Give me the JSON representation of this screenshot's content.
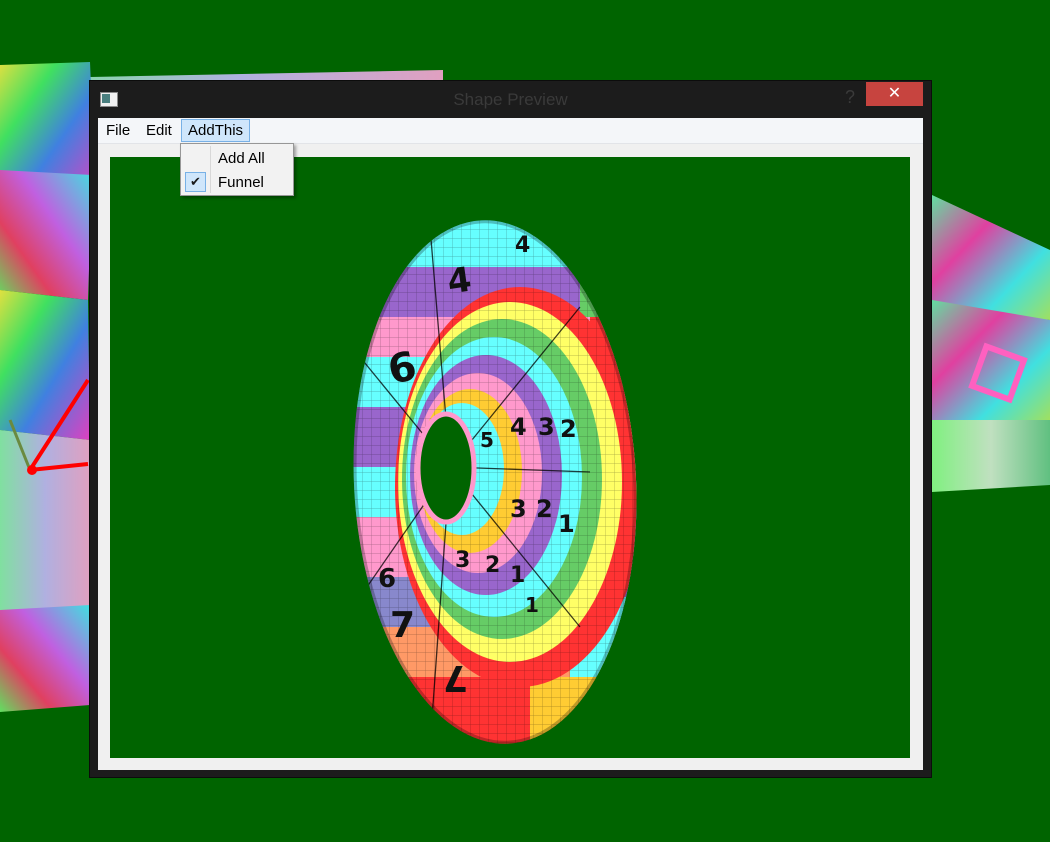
{
  "window": {
    "title": "Shape Preview",
    "help_glyph": "?",
    "close_glyph": "✕"
  },
  "menubar": {
    "items": [
      {
        "label": "File"
      },
      {
        "label": "Edit"
      },
      {
        "label": "AddThis",
        "active": true
      }
    ]
  },
  "dropdown": {
    "items": [
      {
        "label": "Add All",
        "checked": false
      },
      {
        "label": "Funnel",
        "checked": true
      }
    ],
    "check_glyph": "✔"
  },
  "scene": {
    "background_color": "#006400",
    "shape": "funnel",
    "stripe_colors": [
      "#ff3333",
      "#ff9966",
      "#ffff66",
      "#66cc66",
      "#66ffff",
      "#9966cc",
      "#ff99cc",
      "#8888cc",
      "#ffcc33"
    ],
    "digit_labels": [
      "1",
      "2",
      "3",
      "4",
      "5",
      "6",
      "7"
    ]
  },
  "colors": {
    "close_button": "#c7443f",
    "menu_highlight": "#cfe6fb",
    "menu_highlight_border": "#78b1e6"
  }
}
